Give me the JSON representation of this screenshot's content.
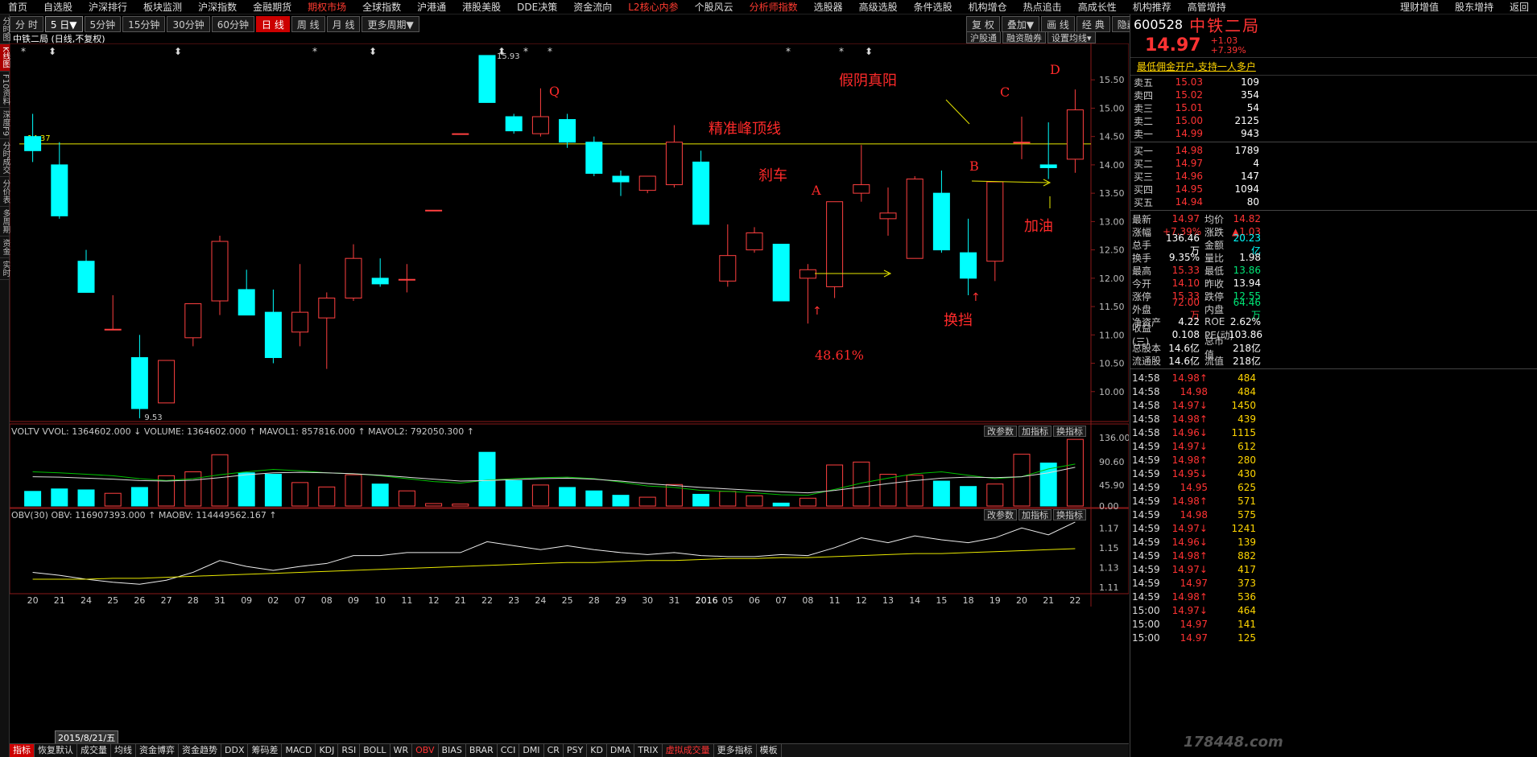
{
  "menu": {
    "items": [
      "首页",
      "自选股",
      "沪深排行",
      "板块监测",
      "沪深指数",
      "金融期货",
      "期权市场",
      "全球指数",
      "沪港通",
      "港股美股",
      "DDE决策",
      "资金流向",
      "L2核心内参",
      "个股风云",
      "分析师指数",
      "选股器",
      "高级选股",
      "条件选股",
      "机构增仓",
      "热点追击",
      "高成长性",
      "机构推荐",
      "高管增持"
    ],
    "right_items": [
      "理财增值",
      "股东增持",
      "返回"
    ],
    "red_items": [
      "期权市场",
      "L2核心内参",
      "分析师指数"
    ]
  },
  "left_strip": [
    "分时图",
    "K线图",
    "F10资料",
    "深度F9",
    "分时成交",
    "分价表",
    "多周期",
    "资金",
    "实时"
  ],
  "left_strip_active": "K线图",
  "toolbar": {
    "periods": [
      "分 时",
      "5 日▼",
      "5分钟",
      "15分钟",
      "30分钟",
      "60分钟",
      "日 线",
      "周 线",
      "月 线",
      "更多周期▼"
    ],
    "selected": "日 线",
    "boxed": "5 日▼",
    "right": [
      "复 权",
      "叠加▼",
      "画 线",
      "经 典",
      "隐藏▶"
    ]
  },
  "chart_header": {
    "title": "中铁二局 (日线,不复权)",
    "buttons": [
      "沪股通",
      "融资融券",
      "设置均线▾"
    ]
  },
  "chart_data": {
    "type": "candlestick",
    "dates": [
      "2015-07-20",
      "2015-07-21",
      "2015-07-24",
      "2015-07-25",
      "2015-07-26",
      "2015-07-27",
      "2015-07-28",
      "2015-07-31",
      "2015-08-09",
      "2015-08-02",
      "2015-08-07",
      "2015-08-08",
      "2015-08-09b",
      "2015-08-10",
      "2015-08-11",
      "2015-08-12",
      "2015-08-21",
      "2015-08-22",
      "2015-08-23",
      "2015-08-24",
      "2015-08-25",
      "2015-08-28",
      "2015-08-29",
      "2015-08-30",
      "2015-08-31",
      "2016-01-04",
      "2016-01-05",
      "2016-01-06",
      "2016-01-07",
      "2016-01-08",
      "2016-01-11",
      "2016-01-12",
      "2016-01-13",
      "2016-01-14",
      "2016-01-15",
      "2016-01-18",
      "2016-01-19",
      "2016-01-20",
      "2016-01-21",
      "2016-01-22"
    ],
    "ohlc": [
      [
        14.5,
        14.9,
        14.05,
        14.25
      ],
      [
        14.0,
        14.4,
        13.05,
        13.1
      ],
      [
        12.3,
        12.5,
        11.8,
        11.75
      ],
      [
        11.1,
        11.7,
        11.1,
        11.1
      ],
      [
        10.6,
        11.0,
        9.53,
        9.7
      ],
      [
        9.8,
        10.55,
        9.8,
        10.55
      ],
      [
        10.95,
        11.55,
        10.8,
        11.55
      ],
      [
        11.6,
        12.75,
        11.35,
        12.65
      ],
      [
        11.8,
        12.15,
        11.4,
        11.35
      ],
      [
        11.4,
        11.8,
        10.5,
        10.6
      ],
      [
        11.05,
        12.25,
        10.8,
        11.4
      ],
      [
        11.3,
        11.75,
        10.4,
        11.65
      ],
      [
        11.65,
        12.6,
        11.6,
        12.35
      ],
      [
        12.0,
        12.35,
        11.85,
        11.9
      ],
      [
        11.98,
        12.25,
        11.75,
        11.98
      ],
      [
        13.2,
        13.2,
        13.2,
        13.2
      ],
      [
        14.55,
        14.55,
        14.55,
        14.55
      ],
      [
        15.93,
        15.93,
        15.1,
        15.1
      ],
      [
        14.85,
        14.9,
        14.55,
        14.6
      ],
      [
        14.55,
        15.35,
        14.5,
        14.85
      ],
      [
        14.8,
        14.9,
        14.3,
        14.4
      ],
      [
        14.4,
        14.5,
        13.8,
        13.85
      ],
      [
        13.8,
        13.9,
        13.45,
        13.7
      ],
      [
        13.55,
        13.8,
        13.5,
        13.8
      ],
      [
        13.65,
        14.7,
        13.6,
        14.4
      ],
      [
        14.05,
        14.25,
        12.95,
        12.95
      ],
      [
        11.95,
        12.95,
        11.85,
        12.4
      ],
      [
        12.5,
        12.9,
        12.45,
        12.8
      ],
      [
        12.6,
        12.6,
        11.6,
        11.6
      ],
      [
        12.0,
        12.25,
        11.2,
        12.15
      ],
      [
        11.85,
        13.35,
        11.65,
        13.35
      ],
      [
        13.5,
        14.35,
        13.35,
        13.65
      ],
      [
        13.05,
        13.6,
        12.75,
        13.15
      ],
      [
        12.35,
        13.8,
        12.35,
        13.75
      ],
      [
        13.5,
        13.9,
        12.45,
        12.5
      ],
      [
        12.45,
        13.05,
        11.7,
        12.0
      ],
      [
        12.3,
        13.7,
        11.95,
        13.7
      ],
      [
        14.4,
        14.85,
        14.1,
        14.4
      ],
      [
        14.0,
        14.75,
        13.75,
        13.95
      ],
      [
        14.1,
        15.33,
        13.86,
        14.97
      ]
    ],
    "ylim": [
      9.5,
      16.0
    ],
    "y_ticks": [
      "15.50",
      "15.00",
      "14.50",
      "14.00",
      "13.50",
      "13.00",
      "12.50",
      "12.00",
      "11.50",
      "11.00",
      "10.50",
      "10.00"
    ],
    "x_labels": [
      "20",
      "21",
      "24",
      "25",
      "26",
      "27",
      "28",
      "31",
      "09",
      "02",
      "07",
      "08",
      "09",
      "10",
      "11",
      "12",
      "21",
      "22",
      "23",
      "24",
      "25",
      "28",
      "29",
      "30",
      "31",
      "2016",
      "05",
      "06",
      "07",
      "08",
      "11",
      "12",
      "13",
      "14",
      "15",
      "18",
      "19",
      "20",
      "21",
      "22"
    ],
    "high_label": "15.93",
    "low_label": "9.53",
    "hline": {
      "value": 14.37,
      "label": "14.37"
    },
    "annotations": [
      "精准峰顶线",
      "假阴真阳",
      "刹车",
      "换挡",
      "加油",
      "48.61%",
      "Q",
      "A",
      "B",
      "C",
      "D"
    ],
    "volume": {
      "header": "VOLTV  VVOL: 1364602.000 ↓ VOLUME: 1364602.000 ↑ MAVOL1: 857816.000 ↑ MAVOL2: 792050.300 ↑",
      "ylim": [
        0,
        1400000
      ],
      "y_ticks": [
        "136.00",
        "90.60",
        "45.90",
        "0.00"
      ],
      "values": [
        300000,
        350000,
        330000,
        260000,
        380000,
        620000,
        700000,
        1050000,
        680000,
        650000,
        480000,
        390000,
        640000,
        450000,
        310000,
        50000,
        40000,
        1100000,
        520000,
        430000,
        380000,
        310000,
        220000,
        180000,
        440000,
        240000,
        300000,
        210000,
        60000,
        160000,
        840000,
        900000,
        650000,
        630000,
        510000,
        400000,
        450000,
        1060000,
        880000,
        1364602
      ],
      "ma1": [
        700000,
        680000,
        650000,
        620000,
        560000,
        520000,
        560000,
        640000,
        700000,
        750000,
        720000,
        680000,
        660000,
        620000,
        560000,
        500000,
        470000,
        530000,
        560000,
        580000,
        590000,
        560000,
        490000,
        410000,
        380000,
        320000,
        300000,
        270000,
        230000,
        220000,
        340000,
        470000,
        570000,
        660000,
        700000,
        630000,
        560000,
        600000,
        760000,
        857816
      ],
      "ma2": [
        600000,
        590000,
        570000,
        550000,
        520000,
        510000,
        530000,
        580000,
        640000,
        680000,
        690000,
        680000,
        660000,
        630000,
        590000,
        550000,
        510000,
        520000,
        540000,
        560000,
        570000,
        550000,
        510000,
        460000,
        420000,
        380000,
        350000,
        320000,
        290000,
        270000,
        320000,
        390000,
        460000,
        520000,
        570000,
        590000,
        580000,
        600000,
        680000,
        792050
      ]
    },
    "obv": {
      "header": "OBV(30)  OBV: 116907393.000 ↑ MAOBV: 114449562.167 ↑",
      "ylim": [
        1.105,
        1.18
      ],
      "y_ticks": [
        "1.17",
        "1.15",
        "1.13",
        "1.11"
      ],
      "values": [
        1.125,
        1.122,
        1.118,
        1.115,
        1.113,
        1.117,
        1.125,
        1.137,
        1.131,
        1.127,
        1.131,
        1.134,
        1.142,
        1.142,
        1.145,
        1.145,
        1.145,
        1.156,
        1.152,
        1.148,
        1.152,
        1.148,
        1.145,
        1.143,
        1.145,
        1.142,
        1.141,
        1.141,
        1.143,
        1.142,
        1.15,
        1.16,
        1.155,
        1.162,
        1.158,
        1.155,
        1.16,
        1.17,
        1.163,
        1.176
      ],
      "ma": [
        1.118,
        1.118,
        1.118,
        1.119,
        1.119,
        1.12,
        1.121,
        1.122,
        1.123,
        1.124,
        1.125,
        1.126,
        1.127,
        1.128,
        1.129,
        1.13,
        1.131,
        1.132,
        1.133,
        1.134,
        1.135,
        1.135,
        1.136,
        1.137,
        1.137,
        1.138,
        1.139,
        1.139,
        1.14,
        1.14,
        1.141,
        1.142,
        1.143,
        1.144,
        1.144,
        1.145,
        1.146,
        1.147,
        1.148,
        1.149
      ]
    }
  },
  "indicator_buttons": [
    "改参数",
    "加指标",
    "换指标"
  ],
  "quote": {
    "code": "600528",
    "name": "中铁二局",
    "price": "14.97",
    "change": "+1.03",
    "pct": "+7.39%",
    "ad": "最低佣金开户,支持一人多户",
    "asks": [
      [
        "卖五",
        "15.03",
        "109"
      ],
      [
        "卖四",
        "15.02",
        "354"
      ],
      [
        "卖三",
        "15.01",
        "54"
      ],
      [
        "卖二",
        "15.00",
        "2125"
      ],
      [
        "卖一",
        "14.99",
        "943"
      ]
    ],
    "bids": [
      [
        "买一",
        "14.98",
        "1789"
      ],
      [
        "买二",
        "14.97",
        "4"
      ],
      [
        "买三",
        "14.96",
        "147"
      ],
      [
        "买四",
        "14.95",
        "1094"
      ],
      [
        "买五",
        "14.94",
        "80"
      ]
    ],
    "stats": [
      [
        "最新",
        "14.97",
        "red",
        "均价",
        "14.82",
        "red"
      ],
      [
        "涨幅",
        "+7.39%",
        "red",
        "涨跌",
        "▲1.03",
        "red"
      ],
      [
        "总手",
        "136.46万",
        "white",
        "金额",
        "20.23亿",
        "cyan"
      ],
      [
        "换手",
        "9.35%",
        "white",
        "量比",
        "1.98",
        "white"
      ],
      [
        "最高",
        "15.33",
        "red",
        "最低",
        "13.86",
        "grn"
      ],
      [
        "今开",
        "14.10",
        "red",
        "昨收",
        "13.94",
        "white"
      ],
      [
        "涨停",
        "15.33",
        "red",
        "跌停",
        "12.55",
        "grn"
      ],
      [
        "外盘",
        "72.00万",
        "red",
        "内盘",
        "64.46万",
        "grn"
      ],
      [
        "净资产",
        "4.22",
        "white",
        "ROE",
        "2.62%",
        "white"
      ],
      [
        "收益(三)",
        "0.108",
        "white",
        "PE(动)",
        "103.86",
        "white"
      ],
      [
        "总股本",
        "14.6亿",
        "white",
        "总市值",
        "218亿",
        "white"
      ],
      [
        "流通股",
        "14.6亿",
        "white",
        "流值",
        "218亿",
        "white"
      ]
    ],
    "ticks": [
      [
        "14:58",
        "14.98↑",
        "red",
        "484"
      ],
      [
        "14:58",
        "14.98",
        "red",
        "484"
      ],
      [
        "14:58",
        "14.97↓",
        "red",
        "1450"
      ],
      [
        "14:58",
        "14.98↑",
        "red",
        "439"
      ],
      [
        "14:58",
        "14.96↓",
        "red",
        "1115"
      ],
      [
        "14:59",
        "14.97↓",
        "red",
        "612"
      ],
      [
        "14:59",
        "14.98↑",
        "red",
        "280"
      ],
      [
        "14:59",
        "14.95↓",
        "red",
        "430"
      ],
      [
        "14:59",
        "14.95",
        "red",
        "625"
      ],
      [
        "14:59",
        "14.98↑",
        "red",
        "571"
      ],
      [
        "14:59",
        "14.98",
        "red",
        "575"
      ],
      [
        "14:59",
        "14.97↓",
        "red",
        "1241"
      ],
      [
        "14:59",
        "14.96↓",
        "red",
        "139"
      ],
      [
        "14:59",
        "14.98↑",
        "red",
        "882"
      ],
      [
        "14:59",
        "14.97↓",
        "red",
        "417"
      ],
      [
        "14:59",
        "14.97",
        "red",
        "373"
      ],
      [
        "14:59",
        "14.98↑",
        "red",
        "536"
      ],
      [
        "15:00",
        "14.97↓",
        "red",
        "464"
      ],
      [
        "15:00",
        "14.97",
        "red",
        "141"
      ],
      [
        "15:00",
        "14.97",
        "red",
        "125"
      ]
    ]
  },
  "bottom_tabs": [
    "指标",
    "恢复默认",
    "成交量",
    "均线",
    "资金博弈",
    "资金趋势",
    "DDX",
    "筹码差",
    "MACD",
    "KDJ",
    "RSI",
    "BOLL",
    "WR",
    "OBV",
    "BIAS",
    "BRAR",
    "CCI",
    "DMI",
    "CR",
    "PSY",
    "KD",
    "DMA",
    "TRIX",
    "虚拟成交量",
    "更多指标",
    "模板"
  ],
  "bottom_selected": "指标",
  "bottom_red": [
    "OBV",
    "虚拟成交量"
  ],
  "cursor_date": "2015/8/21/五",
  "watermark": "178448.com"
}
